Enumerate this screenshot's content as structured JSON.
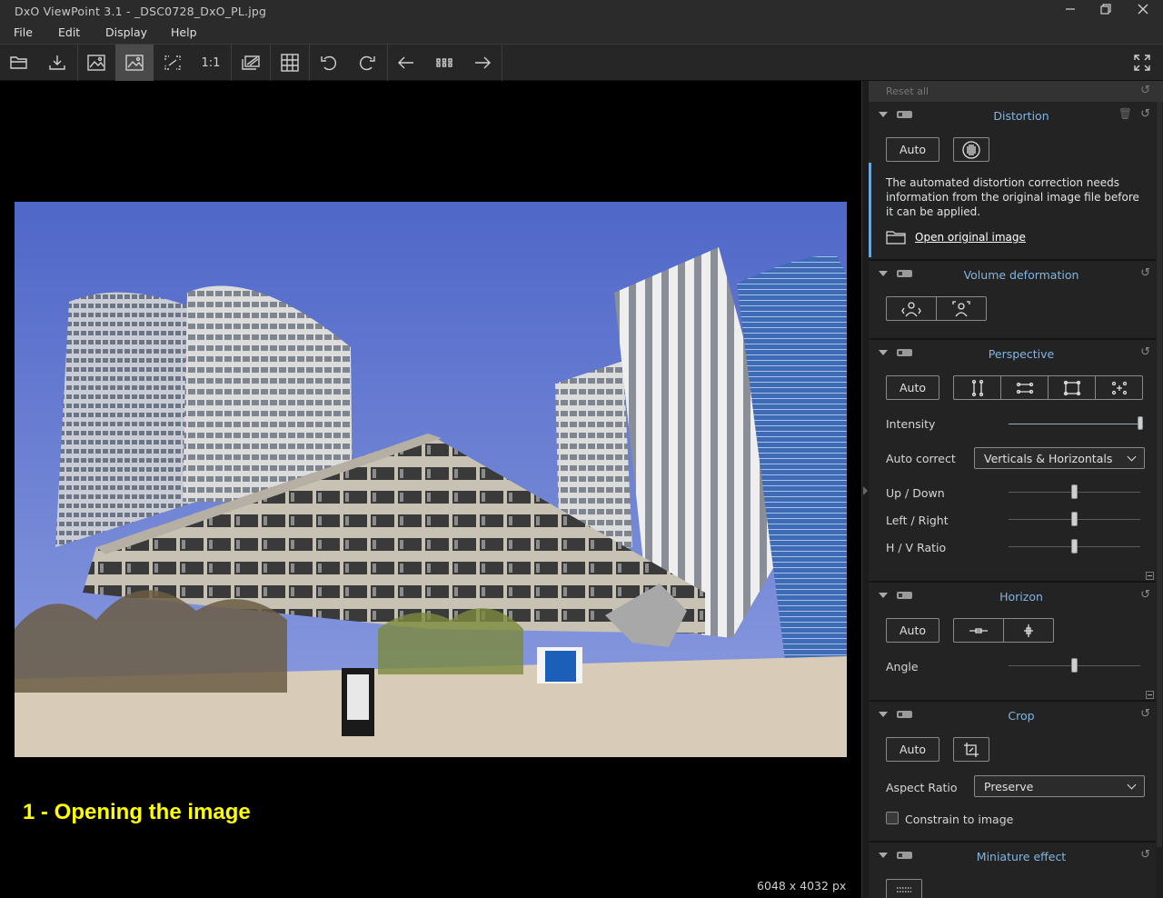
{
  "window": {
    "title": "DxO ViewPoint 3.1 - _DSC0728_DxO_PL.jpg",
    "controls": [
      "minimize-icon",
      "restore-icon",
      "close-icon"
    ]
  },
  "menu": {
    "file": "File",
    "edit": "Edit",
    "display": "Display",
    "help": "Help"
  },
  "toolbar": {
    "one_to_one": "1:1",
    "icons": [
      "open-folder-icon",
      "export-icon",
      "original-image-icon",
      "corrected-image-icon",
      "fit-screen-icon",
      "one-to-one-zoom",
      "compare-icon",
      "grid-icon",
      "rotate-left-icon",
      "rotate-right-icon",
      "previous-arrow-icon",
      "thumbnails-icon",
      "next-arrow-icon",
      "fullscreen-icon"
    ]
  },
  "viewer": {
    "caption": "1 - Opening the image",
    "dimensions": "6048 x 4032 px",
    "caption_color": "#ffff00"
  },
  "panel": {
    "reset_all": "Reset all",
    "accent": "#7fb6e6",
    "distortion": {
      "title": "Distortion",
      "auto": "Auto",
      "info": "The automated distortion correction needs information from the original image file before it can be applied.",
      "open_original": "Open original image"
    },
    "volume": {
      "title": "Volume deformation"
    },
    "perspective": {
      "title": "Perspective",
      "auto": "Auto",
      "intensity_label": "Intensity",
      "auto_correct_label": "Auto correct",
      "auto_correct_value": "Verticals & Horizontals",
      "up_down": "Up / Down",
      "left_right": "Left / Right",
      "hv_ratio": "H / V Ratio"
    },
    "horizon": {
      "title": "Horizon",
      "auto": "Auto",
      "angle": "Angle"
    },
    "crop": {
      "title": "Crop",
      "auto": "Auto",
      "aspect_label": "Aspect Ratio",
      "aspect_value": "Preserve",
      "constrain": "Constrain to image"
    },
    "miniature": {
      "title": "Miniature effect"
    }
  }
}
